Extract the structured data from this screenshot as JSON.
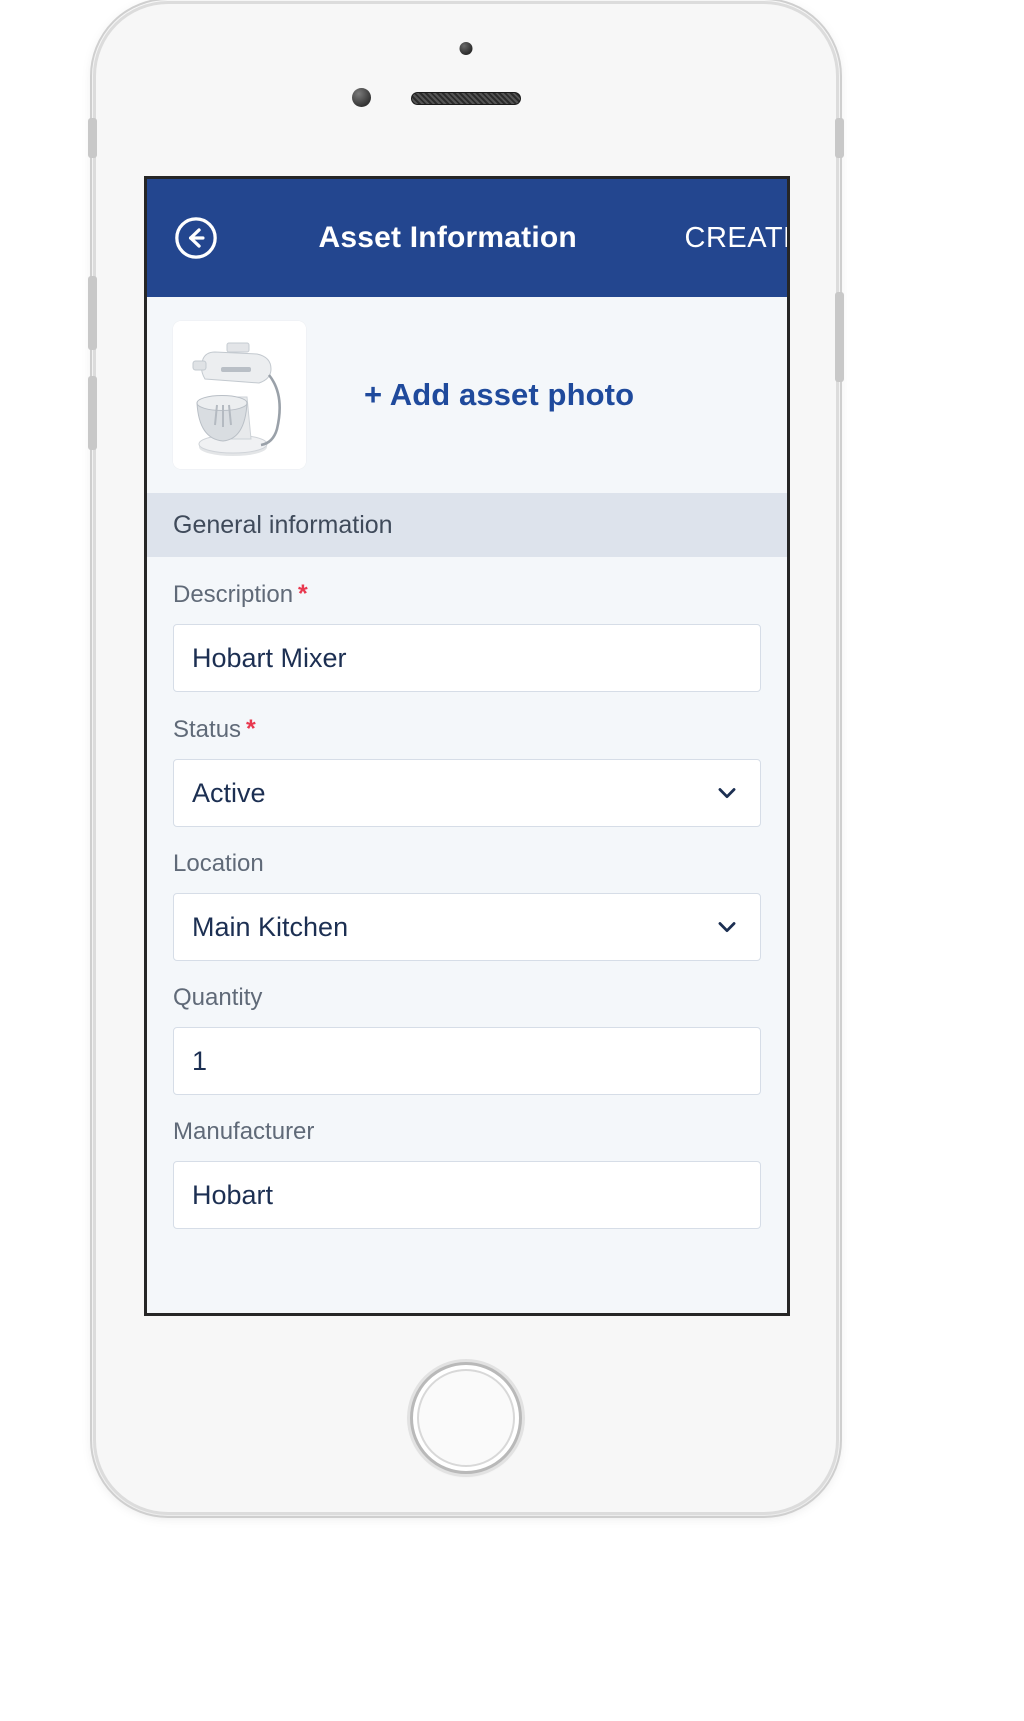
{
  "device": {
    "type": "smartphone-mockup",
    "home_button": "home-button",
    "earpiece": "earpiece-speaker",
    "front_camera": "front-camera"
  },
  "app_bar": {
    "back_icon": "back-arrow-circle-icon",
    "title": "Asset Information",
    "action_label": "CREATE",
    "background_color": "#23468f",
    "text_color": "#ffffff"
  },
  "photo_row": {
    "thumbnail_alt": "stand-mixer-photo",
    "add_photo_label": "+ Add asset photo",
    "link_color": "#1f4a9c"
  },
  "section": {
    "general_information": "General information",
    "header_background": "#dde3ec"
  },
  "form": {
    "required_marker": "*",
    "required_color": "#e8384f",
    "fields": [
      {
        "label": "Description",
        "required": true,
        "type": "text",
        "value": "Hobart Mixer",
        "placeholder": "Description"
      },
      {
        "label": "Status",
        "required": true,
        "type": "select",
        "value": "Active",
        "placeholder": "Status"
      },
      {
        "label": "Location",
        "required": false,
        "type": "select",
        "value": "Main Kitchen",
        "placeholder": "Location"
      },
      {
        "label": "Quantity",
        "required": false,
        "type": "number",
        "value": "1",
        "placeholder": "Quantity"
      },
      {
        "label": "Manufacturer",
        "required": false,
        "type": "text",
        "value": "Hobart",
        "placeholder": "Manufacturer"
      }
    ]
  }
}
